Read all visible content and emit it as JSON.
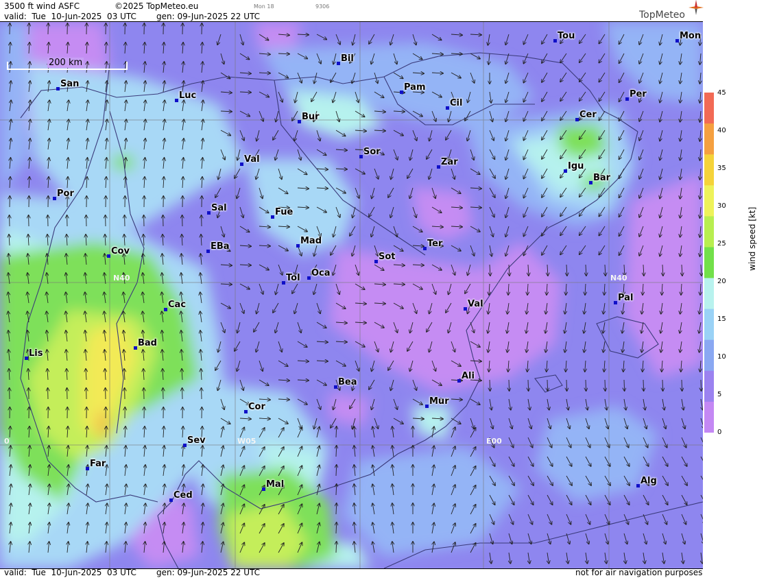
{
  "header": {
    "title": "3500 ft wind ASFC",
    "copyright": "©2025 TopMeteo.eu",
    "run_small": "Mon 18",
    "code_small": "9306",
    "valid": "valid:  Tue  10-Jun-2025  03 UTC",
    "gen": "gen: 09-Jun-2025 22 UTC",
    "logo": "TopMeteo"
  },
  "footer": {
    "valid": "valid:  Tue  10-Jun-2025  03 UTC",
    "gen": "gen: 09-Jun-2025 22 UTC",
    "disclaimer": "not for air navigation purposes"
  },
  "scale": {
    "label": "200 km"
  },
  "grid_labels": {
    "n40_left": "N40",
    "n40_right": "N40",
    "w05": "W05",
    "e00": "E00",
    "zero": "0"
  },
  "cities": [
    {
      "id": "tou",
      "name": "Tou"
    },
    {
      "id": "mon",
      "name": "Mon"
    },
    {
      "id": "bil",
      "name": "Bil"
    },
    {
      "id": "san",
      "name": "San"
    },
    {
      "id": "pam",
      "name": "Pam"
    },
    {
      "id": "luc",
      "name": "Luc"
    },
    {
      "id": "cil",
      "name": "Cil"
    },
    {
      "id": "per",
      "name": "Per"
    },
    {
      "id": "bur",
      "name": "Bur"
    },
    {
      "id": "cer",
      "name": "Cer"
    },
    {
      "id": "sor",
      "name": "Sor"
    },
    {
      "id": "val1",
      "name": "Val"
    },
    {
      "id": "zar",
      "name": "Zar"
    },
    {
      "id": "igu",
      "name": "Igu"
    },
    {
      "id": "bar",
      "name": "Bar"
    },
    {
      "id": "por",
      "name": "Por"
    },
    {
      "id": "sal",
      "name": "Sal"
    },
    {
      "id": "fue",
      "name": "Fue"
    },
    {
      "id": "mad",
      "name": "Mad"
    },
    {
      "id": "eba",
      "name": "EBa"
    },
    {
      "id": "cov",
      "name": "Cov"
    },
    {
      "id": "sot",
      "name": "Sot"
    },
    {
      "id": "ter",
      "name": "Ter"
    },
    {
      "id": "tol",
      "name": "Tol"
    },
    {
      "id": "oca",
      "name": "Oca"
    },
    {
      "id": "pal",
      "name": "Pal"
    },
    {
      "id": "cac",
      "name": "Cac"
    },
    {
      "id": "val2",
      "name": "Val"
    },
    {
      "id": "bad",
      "name": "Bad"
    },
    {
      "id": "lis",
      "name": "Lis"
    },
    {
      "id": "ali",
      "name": "Ali"
    },
    {
      "id": "bea",
      "name": "Bea"
    },
    {
      "id": "mur",
      "name": "Mur"
    },
    {
      "id": "cor",
      "name": "Cor"
    },
    {
      "id": "sev",
      "name": "Sev"
    },
    {
      "id": "far",
      "name": "Far"
    },
    {
      "id": "alg",
      "name": "Alg"
    },
    {
      "id": "mal",
      "name": "Mal"
    },
    {
      "id": "ced",
      "name": "Ced"
    }
  ],
  "legend": {
    "title": "wind speed [kt]",
    "ticks": [
      "45",
      "40",
      "35",
      "30",
      "25",
      "20",
      "15",
      "10",
      "5",
      "0"
    ],
    "colors": [
      "#f26a55",
      "#f5a040",
      "#f5d33a",
      "#eef25a",
      "#b8ee50",
      "#72e04a",
      "#b8f2ee",
      "#9ad2f6",
      "#8aa8f2",
      "#9b82f0",
      "#c488f4"
    ]
  },
  "map_colors": {
    "purple": "#8e86ef",
    "violet": "#c58cf3",
    "blue": "#94b4f6",
    "lightblue": "#a8d8f6",
    "cyan": "#b6f2ee",
    "green": "#7ee05a",
    "lime": "#c4ee5a",
    "yellow": "#f2ea56",
    "orange": "#f0b24a",
    "border": "#3a3a7a",
    "grid": "#777777"
  }
}
